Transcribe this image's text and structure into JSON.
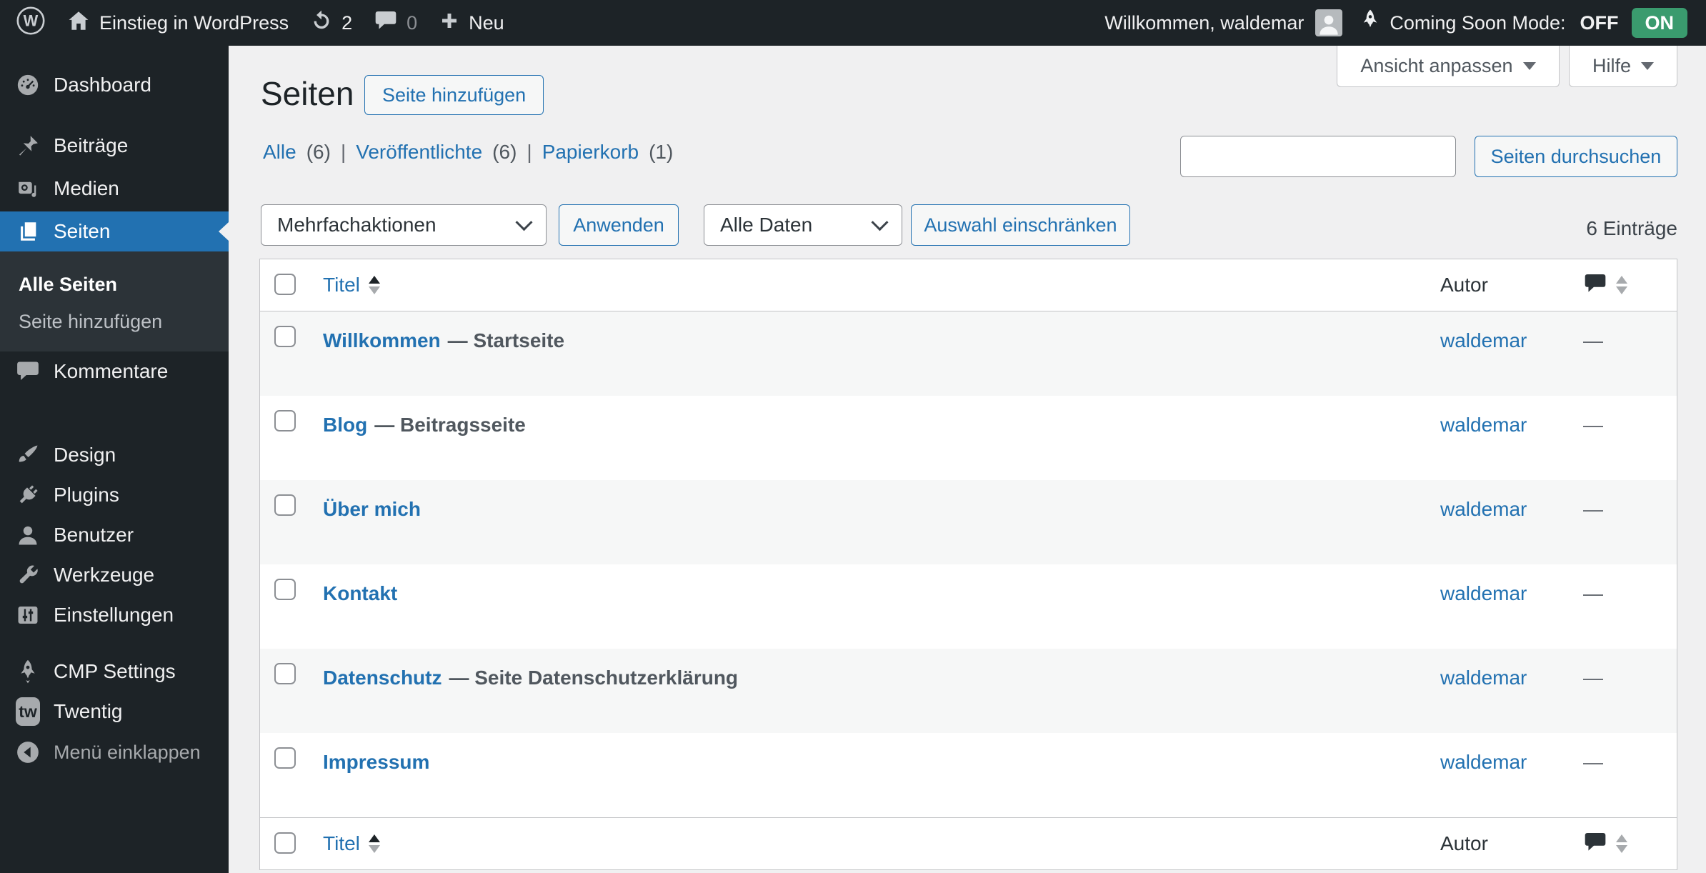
{
  "colors": {
    "accent_blue": "#2271b1",
    "admin_bar_bg": "#1d2327",
    "submenu_bg": "#2c3338",
    "page_bg": "#f0f0f1",
    "toggle_on_green": "#3a9b6e",
    "row_alt_bg": "#f6f7f7",
    "table_border": "#c3c4c7"
  },
  "admin_bar": {
    "site_name": "Einstieg in WordPress",
    "updates_count": "2",
    "comments_count": "0",
    "new_label": "Neu",
    "greeting": "Willkommen, waldemar",
    "coming_soon_label": "Coming Soon Mode:",
    "toggle_off": "OFF",
    "toggle_on": "ON"
  },
  "sidebar": {
    "items": [
      {
        "label": "Dashboard"
      },
      {
        "label": "Beiträge"
      },
      {
        "label": "Medien"
      },
      {
        "label": "Seiten",
        "active": true
      },
      {
        "label": "Kommentare"
      },
      {
        "label": "Design"
      },
      {
        "label": "Plugins"
      },
      {
        "label": "Benutzer"
      },
      {
        "label": "Werkzeuge"
      },
      {
        "label": "Einstellungen"
      },
      {
        "label": "CMP Settings"
      },
      {
        "label": "Twentig"
      }
    ],
    "submenu": [
      {
        "label": "Alle Seiten",
        "current": true
      },
      {
        "label": "Seite hinzufügen"
      }
    ],
    "twentig_badge": "tw",
    "collapse_label": "Menü einklappen"
  },
  "screen_tabs": {
    "customize_view": "Ansicht anpassen",
    "help": "Hilfe"
  },
  "page": {
    "title": "Seiten",
    "add_button": "Seite hinzufügen",
    "filters": [
      {
        "label": "Alle",
        "count": "(6)"
      },
      {
        "label": "Veröffentlichte",
        "count": "(6)"
      },
      {
        "label": "Papierkorb",
        "count": "(1)"
      }
    ],
    "filter_divider": "|",
    "search_value": "",
    "search_button": "Seiten durchsuchen",
    "bulk_action_select": "Mehrfachaktionen",
    "apply_button": "Anwenden",
    "date_select": "Alle Daten",
    "restrict_button": "Auswahl einschränken",
    "items_count": "6 Einträge"
  },
  "table": {
    "columns": {
      "title": "Titel",
      "author": "Autor"
    },
    "rows": [
      {
        "title": "Willkommen",
        "suffix": "— Startseite",
        "author": "waldemar",
        "comments": "—"
      },
      {
        "title": "Blog",
        "suffix": "— Beitragsseite",
        "author": "waldemar",
        "comments": "—"
      },
      {
        "title": "Über mich",
        "suffix": "",
        "author": "waldemar",
        "comments": "—"
      },
      {
        "title": "Kontakt",
        "suffix": "",
        "author": "waldemar",
        "comments": "—"
      },
      {
        "title": "Datenschutz",
        "suffix": "— Seite Datenschutzerklärung",
        "author": "waldemar",
        "comments": "—"
      },
      {
        "title": "Impressum",
        "suffix": "",
        "author": "waldemar",
        "comments": "—"
      }
    ]
  }
}
